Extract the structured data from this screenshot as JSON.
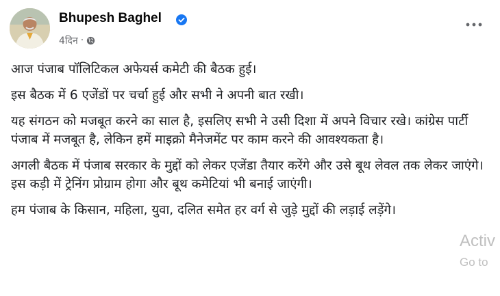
{
  "post": {
    "author": "Bhupesh Baghel",
    "timestamp": "4दिन",
    "separator": "·",
    "avatar_icon": "avatar-photo",
    "verified_icon": "verified-badge",
    "privacy_icon": "globe-icon",
    "more_icon": "more-dots-icon",
    "paragraphs": [
      "आज पंजाब पॉलिटिकल अफेयर्स कमेटी की बैठक हुई।",
      "इस बैठक में 6 एजेंडों पर चर्चा हुई और सभी ने अपनी बात रखी।",
      "यह संगठन को मजबूत करने का साल है, इसलिए सभी ने उसी दिशा में अपने विचार रखे। कांग्रेस पार्टी पंजाब में मजबूत है, लेकिन हमें माइक्रो मैनेजमेंट पर काम करने की आवश्यकता है।",
      "अगली बैठक में पंजाब सरकार के मुद्दों को लेकर एजेंडा तैयार करेंगे और उसे बूथ लेवल तक लेकर जाएंगे। इस कड़ी में ट्रेनिंग प्रोग्राम होगा और बूथ कमेटियां भी बनाई जाएंगी।",
      "हम पंजाब के किसान, महिला, युवा, दलित समेत हर वर्ग से जुड़े मुद्दों की लड़ाई लड़ेंगे।"
    ]
  },
  "watermark": {
    "line1": "Activ",
    "line2": "Go to"
  },
  "colors": {
    "verified": "#1877f2",
    "meta": "#65676b",
    "text": "#1c1e21"
  }
}
